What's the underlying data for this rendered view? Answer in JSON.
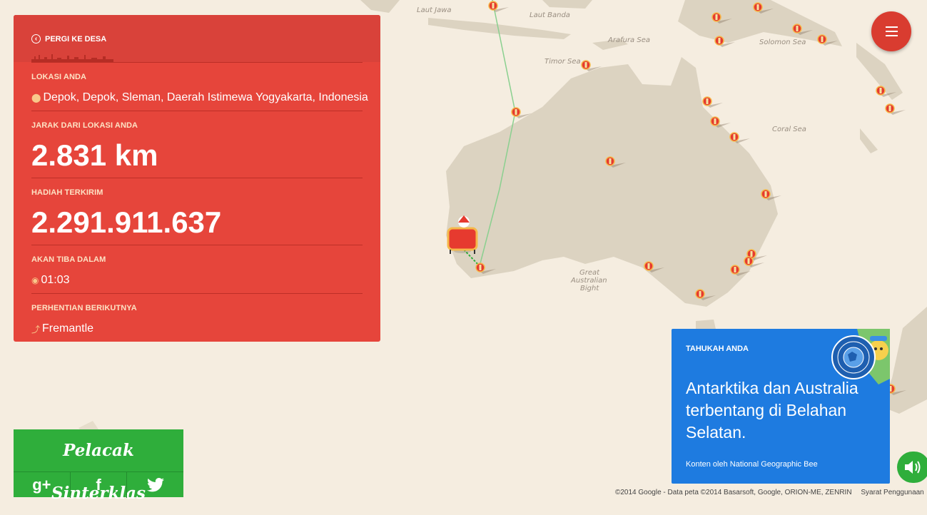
{
  "panel": {
    "back_label": "PERGI KE DESA",
    "location_label": "LOKASI ANDA",
    "location_value": "Depok, Depok, Sleman, Daerah Istimewa Yogyakarta, Indonesia",
    "distance_label": "JARAK DARI LOKASI ANDA",
    "distance_value": "2.831 km",
    "gifts_label": "HADIAH TERKIRIM",
    "gifts_value": "2.291.911.637",
    "arrival_label": "AKAN TIBA DALAM",
    "arrival_value": "01:03",
    "next_stop_label": "PERHENTIAN BERIKUTNYA",
    "next_stop_value": "Fremantle"
  },
  "map_labels": {
    "java_sea": "Laut Jawa",
    "banda_sea": "Laut Banda",
    "arafura_sea": "Arafura Sea",
    "timor_sea": "Timor Sea",
    "solomon_sea": "Solomon Sea",
    "coral_sea": "Coral Sea",
    "bight_1": "Great",
    "bight_2": "Australian",
    "bight_3": "Bight"
  },
  "fact_card": {
    "heading": "TAHUKAH ANDA",
    "text": "Antarktika dan Australia terbentang di Belahan Selatan.",
    "credit": "Konten oleh National Geographic Bee"
  },
  "tracker": {
    "title": "Pelacak Sinterklas"
  },
  "share": {
    "gplus": "g+",
    "facebook": "f",
    "twitter": "🐦"
  },
  "icons": {
    "back": "back-arrow-icon",
    "location": "location-pin-icon",
    "timer": "timer-icon",
    "next": "next-stop-icon",
    "menu": "hamburger-icon",
    "sound": "speaker-icon"
  },
  "attribution": {
    "text": "©2014 Google - Data peta ©2014 Basarsoft, Google, ORION-ME, ZENRIN",
    "terms": "Syarat Penggunaan"
  },
  "colors": {
    "panel_red": "#e6453b",
    "card_blue": "#1e7be0",
    "tracker_green": "#2fae3b",
    "map_ocean": "#f5ede0",
    "map_land": "#dcd3c1"
  }
}
